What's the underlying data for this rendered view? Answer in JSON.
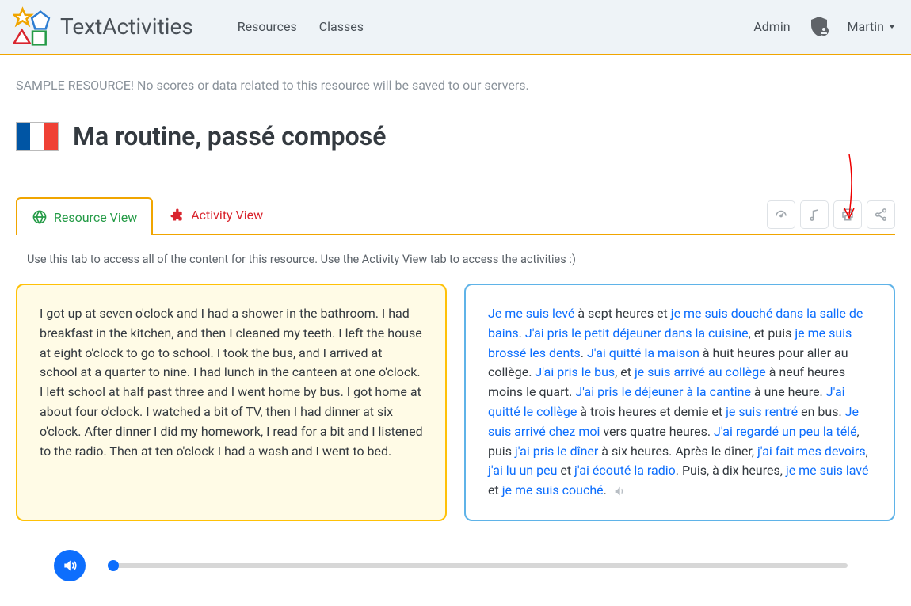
{
  "header": {
    "brand": "TextActivities",
    "nav": {
      "resources": "Resources",
      "classes": "Classes"
    },
    "admin": "Admin",
    "user": "Martin"
  },
  "sample_notice": "SAMPLE RESOURCE! No scores or data related to this resource will be saved to our servers.",
  "title": "Ma routine, passé composé",
  "tabs": {
    "resource": "Resource View",
    "activity": "Activity View"
  },
  "tab_help": "Use this tab to access all of the content for this resource. Use the Activity View tab to access the activities :)",
  "english_text": "I got up at seven o'clock and I had a shower in the bathroom. I had breakfast in the kitchen, and then I cleaned my teeth. I left the house at eight o'clock to go to school. I took the bus, and I arrived at school at a quarter to nine. I had lunch in the canteen at one o'clock. I left school at half past three and I went home by bus. I got home at about four o'clock. I watched a bit of TV, then I had dinner at six o'clock. After dinner I did my homework, I read for a bit and I listened to the radio. Then at ten o'clock I had a wash and I went to bed.",
  "french": {
    "p1a": "Je me suis levé",
    "p1b": " à sept heures et ",
    "p1c": "je me suis douché dans la salle de bains",
    "p1d": ". ",
    "p2a": "J'ai pris le petit déjeuner dans la cuisine",
    "p2b": ", et puis ",
    "p3a": "je me suis brossé les dents",
    "p3b": ". ",
    "p4a": "J'ai quitté la maison",
    "p4b": " à huit heures pour aller au collège. ",
    "p5a": "J'ai pris le bus",
    "p5b": ", et ",
    "p6a": "je suis arrivé au collège",
    "p6b": " à neuf heures moins le quart. ",
    "p7a": "J'ai pris le déjeuner à la cantine",
    "p7b": " à une heure. ",
    "p8a": "J'ai quitté le collège",
    "p8b": " à trois heures et demie et ",
    "p9a": "je suis rentré",
    "p9b": " en bus. ",
    "p10a": "Je suis arrivé chez moi",
    "p10b": " vers quatre heures. ",
    "p11a": "J'ai regardé un peu la télé",
    "p11b": ", puis ",
    "p12a": "j'ai pris le dîner",
    "p12b": " à six heures. Après le dîner, ",
    "p13a": "j'ai fait mes devoirs",
    "p13b": ", ",
    "p14a": "j'ai lu un peu",
    "p14b": " et ",
    "p15a": "j'ai écouté la radio",
    "p15b": ". Puis, à dix heures, ",
    "p16a": "je me suis lavé",
    "p16b": " et ",
    "p17a": "je me suis couché",
    "p17b": "."
  },
  "colors": {
    "accent": "#f0a500",
    "link": "#0d6efd",
    "green": "#259b47",
    "red": "#d9252e"
  },
  "annotation_arrow": true
}
